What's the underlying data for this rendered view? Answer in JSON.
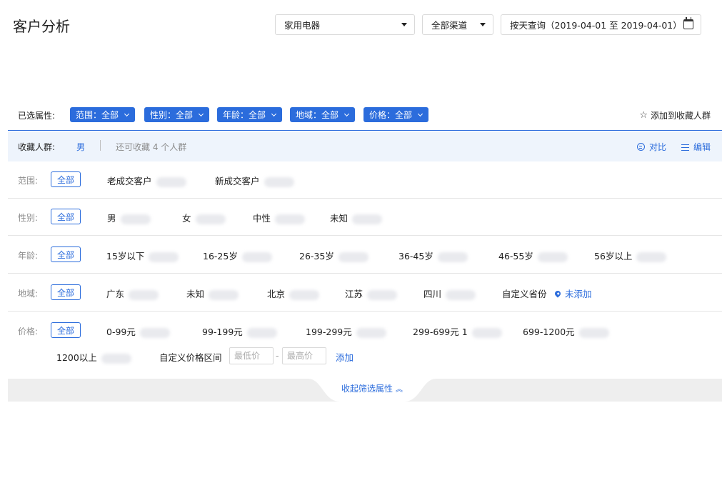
{
  "page": {
    "title": "客户分析"
  },
  "header": {
    "category_select": "家用电器",
    "channel_select": "全部渠道",
    "date_range": "按天查询（2019-04-01 至 2019-04-01）"
  },
  "selected": {
    "label": "已选属性:",
    "tags": [
      {
        "label": "范围：全部"
      },
      {
        "label": "性别：全部"
      },
      {
        "label": "年龄：全部"
      },
      {
        "label": "地域：全部"
      },
      {
        "label": "价格：全部"
      }
    ],
    "add_collection": "添加到收藏人群"
  },
  "collection": {
    "label": "收藏人群:",
    "active": "男",
    "remaining": "还可收藏 4 个人群",
    "compare": "对比",
    "edit": "编辑"
  },
  "filters": {
    "all_label": "全部",
    "scope": {
      "label": "范围:",
      "options": [
        "老成交客户",
        "新成交客户"
      ]
    },
    "gender": {
      "label": "性别:",
      "options": [
        "男",
        "女",
        "中性",
        "未知"
      ]
    },
    "age": {
      "label": "年龄:",
      "options": [
        "15岁以下",
        "16-25岁",
        "26-35岁",
        "36-45岁",
        "46-55岁",
        "56岁以上"
      ]
    },
    "region": {
      "label": "地域:",
      "options": [
        "广东",
        "未知",
        "北京",
        "江苏",
        "四川"
      ],
      "custom_label": "自定义省份",
      "not_added": "未添加"
    },
    "price": {
      "label": "价格:",
      "options": [
        "0-99元",
        "99-199元",
        "199-299元",
        "299-699元",
        "699-1200元",
        "1200以上"
      ],
      "stray_digit": "1",
      "custom_label": "自定义价格区间",
      "min_placeholder": "最低价",
      "max_placeholder": "最高价",
      "dash": "-",
      "add": "添加"
    }
  },
  "collapse": {
    "label": "收起筛选属性"
  },
  "colors": {
    "primary": "#2b6cdc",
    "text": "#333333",
    "muted": "#8c8c8c"
  }
}
